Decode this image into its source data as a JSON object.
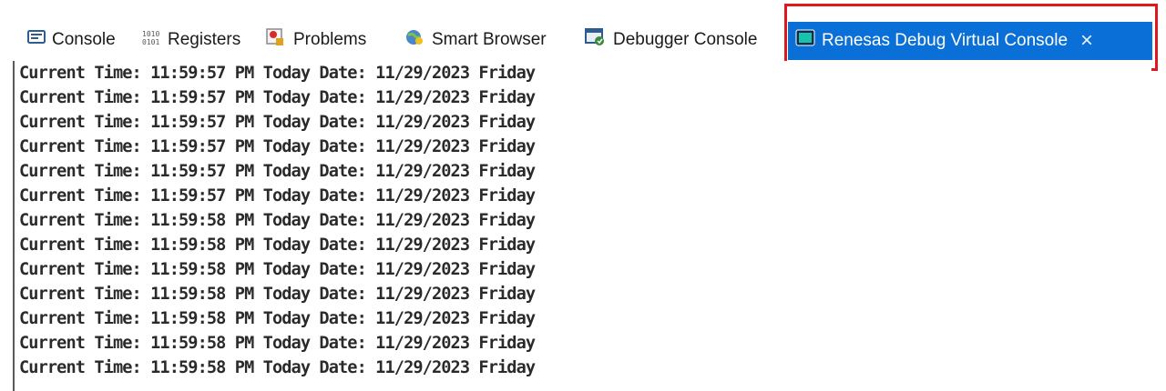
{
  "tabs": [
    {
      "label": "Console",
      "icon": "console-icon"
    },
    {
      "label": "Registers",
      "icon": "registers-icon"
    },
    {
      "label": "Problems",
      "icon": "problems-icon"
    },
    {
      "label": "Smart Browser",
      "icon": "smart-browser-icon"
    },
    {
      "label": "Debugger Console",
      "icon": "debugger-console-icon"
    },
    {
      "label": "Renesas Debug Virtual Console",
      "icon": "virtual-console-icon",
      "active": true,
      "close": "×"
    }
  ],
  "colors": {
    "active_tab": "#0a6fd6",
    "highlight": "#e0181e"
  },
  "console": {
    "lines": [
      "Current Time: 11:59:57 PM Today Date: 11/29/2023 Friday",
      "Current Time: 11:59:57 PM Today Date: 11/29/2023 Friday",
      "Current Time: 11:59:57 PM Today Date: 11/29/2023 Friday",
      "Current Time: 11:59:57 PM Today Date: 11/29/2023 Friday",
      "Current Time: 11:59:57 PM Today Date: 11/29/2023 Friday",
      "Current Time: 11:59:57 PM Today Date: 11/29/2023 Friday",
      "Current Time: 11:59:58 PM Today Date: 11/29/2023 Friday",
      "Current Time: 11:59:58 PM Today Date: 11/29/2023 Friday",
      "Current Time: 11:59:58 PM Today Date: 11/29/2023 Friday",
      "Current Time: 11:59:58 PM Today Date: 11/29/2023 Friday",
      "Current Time: 11:59:58 PM Today Date: 11/29/2023 Friday",
      "Current Time: 11:59:58 PM Today Date: 11/29/2023 Friday",
      "Current Time: 11:59:58 PM Today Date: 11/29/2023 Friday"
    ]
  }
}
